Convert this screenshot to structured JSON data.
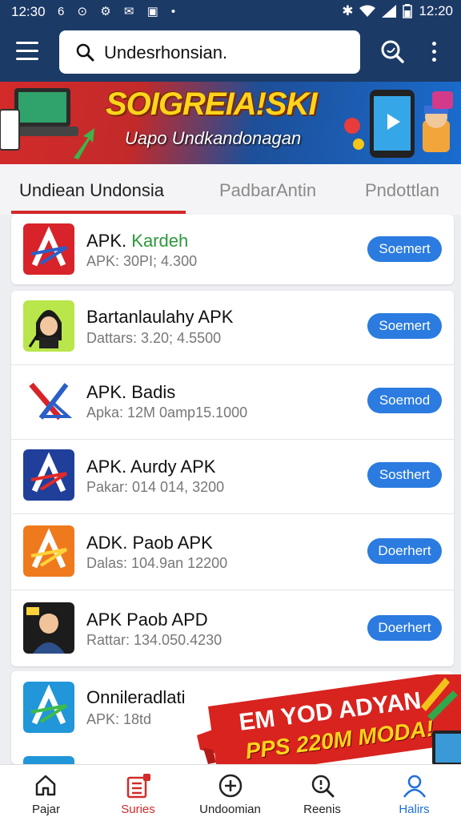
{
  "status_bar": {
    "time": "12:30",
    "right_time": "12:20"
  },
  "search": {
    "query": "Undesrhonsian."
  },
  "banner": {
    "title": "SOIGREIA!SKI",
    "subtitle": "Uapo Undkandonagan"
  },
  "tabs": [
    {
      "label": "Undiean Undonsia",
      "active": true
    },
    {
      "label": "PadbarAntin",
      "active": false
    },
    {
      "label": "Pndottlan",
      "active": false
    }
  ],
  "apps": [
    {
      "name_prefix": "APK.",
      "name_suffix": "Kardeh",
      "meta": "APK: 30PI; 4.300",
      "button": "Soemert",
      "icon": "a-logo-red-icon"
    },
    {
      "name_prefix": "Bartanlaulahy APK",
      "name_suffix": "",
      "meta": "Dattars: 3.20; 4.5500",
      "button": "Soemert",
      "icon": "character-icon"
    },
    {
      "name_prefix": "APK. Badis",
      "name_suffix": "",
      "meta": "Apka: 12M 0amp15.1000",
      "button": "Soemod",
      "icon": "x-logo-icon"
    },
    {
      "name_prefix": "APK. Aurdy APK",
      "name_suffix": "",
      "meta": "Pakar: 014 014, 3200",
      "button": "Sosthert",
      "icon": "a-logo-blue-icon"
    },
    {
      "name_prefix": "ADK. Paob APK",
      "name_suffix": "",
      "meta": "Dalas: 104.9an 12200",
      "button": "Doerhert",
      "icon": "a-logo-orange-icon"
    },
    {
      "name_prefix": "APK Paob APD",
      "name_suffix": "",
      "meta": "Rattar: 134.050.4230",
      "button": "Doerhert",
      "icon": "person-icon"
    },
    {
      "name_prefix": "Onnileradlati",
      "name_suffix": "",
      "meta": "APK: 18td",
      "button": "",
      "icon": "a-logo-green-icon"
    }
  ],
  "promo": {
    "line1": "EM YOD ADYAN",
    "line2": "PPS 220M MODA!"
  },
  "bottom_nav": [
    {
      "label": "Pajar",
      "icon": "home-icon",
      "color": "#222222"
    },
    {
      "label": "Suries",
      "icon": "list-icon",
      "color": "#d32a2a"
    },
    {
      "label": "Undoomian",
      "icon": "plus-circle-icon",
      "color": "#222222"
    },
    {
      "label": "Reenis",
      "icon": "search-icon",
      "color": "#222222"
    },
    {
      "label": "Halirs",
      "icon": "user-icon",
      "color": "#1e6fd9"
    }
  ],
  "colors": {
    "header": "#1c3a66",
    "accent": "#d32a2a",
    "button": "#2b7be0"
  }
}
